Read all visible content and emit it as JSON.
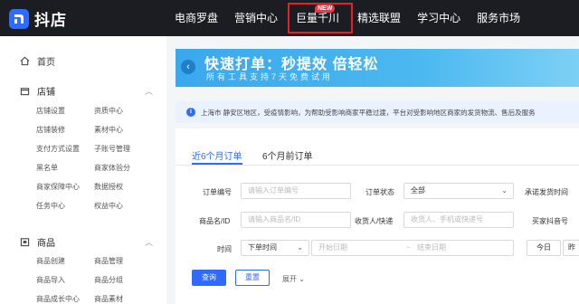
{
  "app": {
    "logo_text": "抖店"
  },
  "nav": {
    "items": [
      "电商罗盘",
      "营销中心",
      "巨量千川",
      "精选联盟",
      "学习中心",
      "服务市场"
    ],
    "new_badge": "NEW"
  },
  "sidebar": {
    "home": "首页",
    "sections": [
      {
        "title": "店铺",
        "links": [
          "店铺设置",
          "资质中心",
          "店铺装修",
          "素材中心",
          "支付方式设置",
          "子账号管理",
          "黑名单",
          "商家体验分",
          "商家保障中心",
          "数据授权",
          "任务中心",
          "权益中心"
        ]
      },
      {
        "title": "商品",
        "links": [
          "商品创建",
          "商品管理",
          "商品导入",
          "商品分组",
          "商品成长中心",
          "商品素材"
        ]
      }
    ]
  },
  "banner": {
    "title": "快速打单：秒提效 倍轻松",
    "subtitle": "所有工具支持7天免费试用"
  },
  "notice": {
    "text": "上海市 静安区地区，受疫情影响，为帮助受影响商家平稳过渡，平台对受影响地区商家的发货物流、售后及服务"
  },
  "tabs": [
    "近6个月订单",
    "6个月前订单"
  ],
  "form": {
    "order_no_label": "订单编号",
    "order_no_placeholder": "请输入订单编号",
    "order_status_label": "订单状态",
    "order_status_value": "全部",
    "ship_time_label": "承诺发货时间",
    "product_label": "商品名/ID",
    "product_placeholder": "请输入商品名/ID",
    "receiver_label": "收货人/快递",
    "receiver_placeholder": "收货人、手机或快递号",
    "author_label": "买家抖音号",
    "time_label": "时间",
    "time_type_value": "下单时间",
    "start_date_placeholder": "开始日期",
    "date_separator": "~",
    "end_date_placeholder": "结束日期",
    "today_button": "今日",
    "yesterday_button": "昨"
  },
  "actions": {
    "search_label": "查询",
    "reset_label": "重置",
    "expand_label": "展开"
  },
  "colors": {
    "topbar": "#1b1d23",
    "accent": "#2f6bff",
    "highlight_border": "#e0202a",
    "new_badge": "#f0364a"
  }
}
